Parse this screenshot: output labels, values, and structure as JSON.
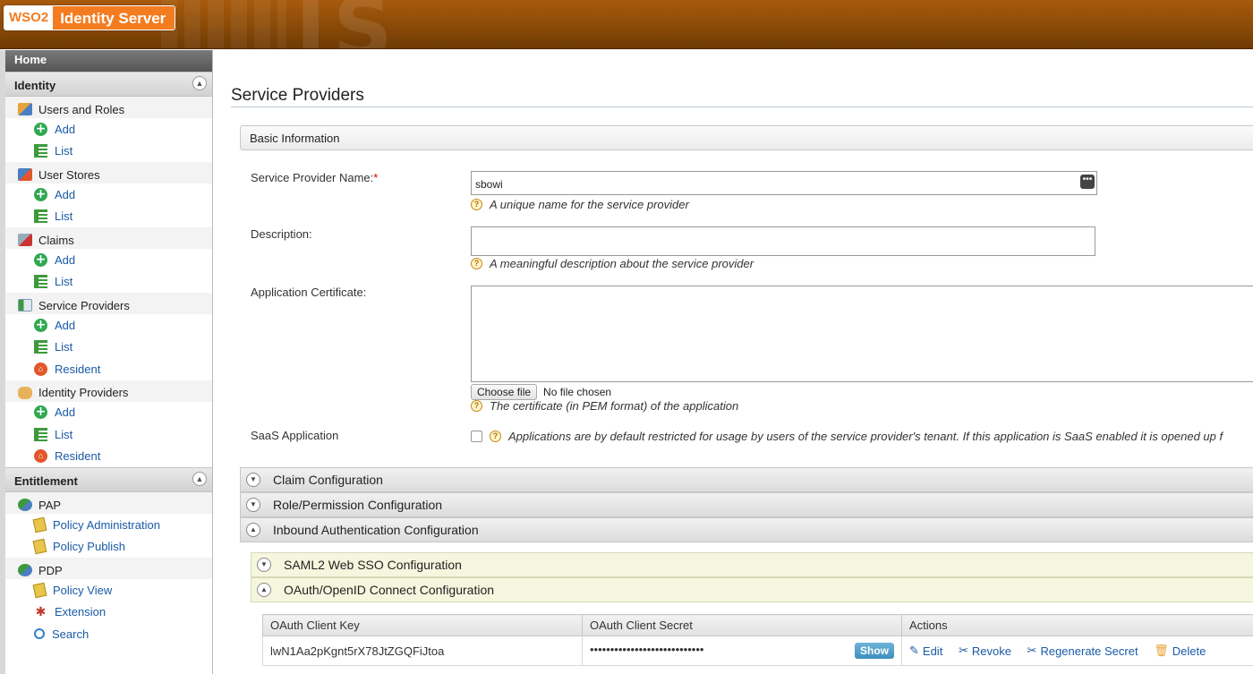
{
  "header": {
    "logo_wso2": "WSO2",
    "product_name": "Identity Server",
    "watermark": "IS"
  },
  "sidebar": {
    "home_label": "Home",
    "sections": [
      {
        "title": "Identity",
        "groups": [
          {
            "label": "Users and Roles",
            "items": [
              "Add",
              "List"
            ]
          },
          {
            "label": "User Stores",
            "items": [
              "Add",
              "List"
            ]
          },
          {
            "label": "Claims",
            "items": [
              "Add",
              "List"
            ]
          },
          {
            "label": "Service Providers",
            "items": [
              "Add",
              "List",
              "Resident"
            ]
          },
          {
            "label": "Identity Providers",
            "items": [
              "Add",
              "List",
              "Resident"
            ]
          }
        ]
      },
      {
        "title": "Entitlement",
        "groups": [
          {
            "label": "PAP",
            "items": [
              "Policy Administration",
              "Policy Publish"
            ]
          },
          {
            "label": "PDP",
            "items": [
              "Policy View",
              "Extension",
              "Search"
            ]
          }
        ]
      }
    ]
  },
  "page": {
    "title": "Service Providers",
    "basic_info_label": "Basic Information",
    "sp_name_label": "Service Provider Name:",
    "required_mark": "*",
    "sp_name_value": "sbowi",
    "sp_name_hint": "A unique name for the service provider",
    "description_label": "Description:",
    "description_value": "",
    "description_hint": "A meaningful description about the service provider",
    "cert_label": "Application Certificate:",
    "cert_value": "",
    "choose_file_label": "Choose file",
    "no_file_text": "No file chosen",
    "cert_hint": "The certificate (in PEM format) of the application",
    "saas_label": "SaaS Application",
    "saas_hint": "Applications are by default restricted for usage by users of the service provider's tenant. If this application is SaaS enabled it is opened up f",
    "sections": {
      "claim": "Claim Configuration",
      "role": "Role/Permission Configuration",
      "inbound": "Inbound Authentication Configuration",
      "saml": "SAML2 Web SSO Configuration",
      "oauth": "OAuth/OpenID Connect Configuration"
    },
    "oauth_table": {
      "headers": [
        "OAuth Client Key",
        "OAuth Client Secret",
        "Actions"
      ],
      "client_key": "lwN1Aa2pKgnt5rX78JtZGQFiJtoa",
      "client_secret_masked": "••••••••••••••••••••••••••••",
      "show_label": "Show",
      "actions": [
        "Edit",
        "Revoke",
        "Regenerate Secret",
        "Delete"
      ]
    }
  }
}
